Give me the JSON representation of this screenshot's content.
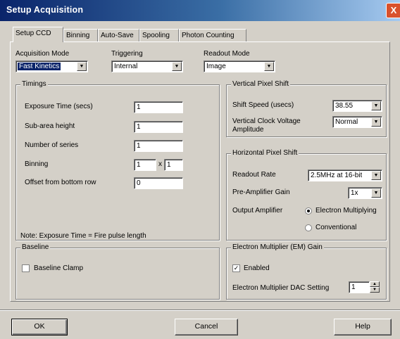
{
  "window": {
    "title": "Setup Acquisition",
    "close_label": "X"
  },
  "tabs": [
    "Setup CCD",
    "Binning",
    "Auto-Save",
    "Spooling",
    "Photon Counting"
  ],
  "top": {
    "acq_mode_label": "Acquisition Mode",
    "acq_mode_value": "Fast Kinetics",
    "triggering_label": "Triggering",
    "triggering_value": "Internal",
    "readout_label": "Readout Mode",
    "readout_value": "Image"
  },
  "timings": {
    "title": "Timings",
    "rows": [
      {
        "label": "Exposure Time (secs)",
        "value": "1"
      },
      {
        "label": "Sub-area height",
        "value": "1"
      },
      {
        "label": "Number of series",
        "value": "1"
      },
      {
        "label": "Binning",
        "value": "1",
        "value2": "1",
        "sep": "x"
      },
      {
        "label": "Offset from bottom row",
        "value": "0"
      }
    ],
    "note": "Note: Exposure Time = Fire pulse length"
  },
  "baseline": {
    "title": "Baseline",
    "clamp_label": "Baseline Clamp"
  },
  "vertical": {
    "title": "Vertical Pixel Shift",
    "shift_speed_label": "Shift Speed (usecs)",
    "shift_speed_value": "38.55",
    "clock_label": "Vertical Clock Voltage Amplitude",
    "clock_value": "Normal"
  },
  "horizontal": {
    "title": "Horizontal Pixel Shift",
    "readout_rate_label": "Readout Rate",
    "readout_rate_value": "2.5MHz at 16-bit",
    "preamp_label": "Pre-Amplifier Gain",
    "preamp_value": "1x",
    "output_amp_label": "Output Amplifier",
    "opt_em": "Electron Multiplying",
    "opt_conv": "Conventional"
  },
  "em": {
    "title": "Electron Multiplier (EM) Gain",
    "enabled_label": "Enabled",
    "dac_label": "Electron Multiplier DAC Setting",
    "dac_value": "1"
  },
  "buttons": {
    "ok": "OK",
    "cancel": "Cancel",
    "help": "Help"
  }
}
